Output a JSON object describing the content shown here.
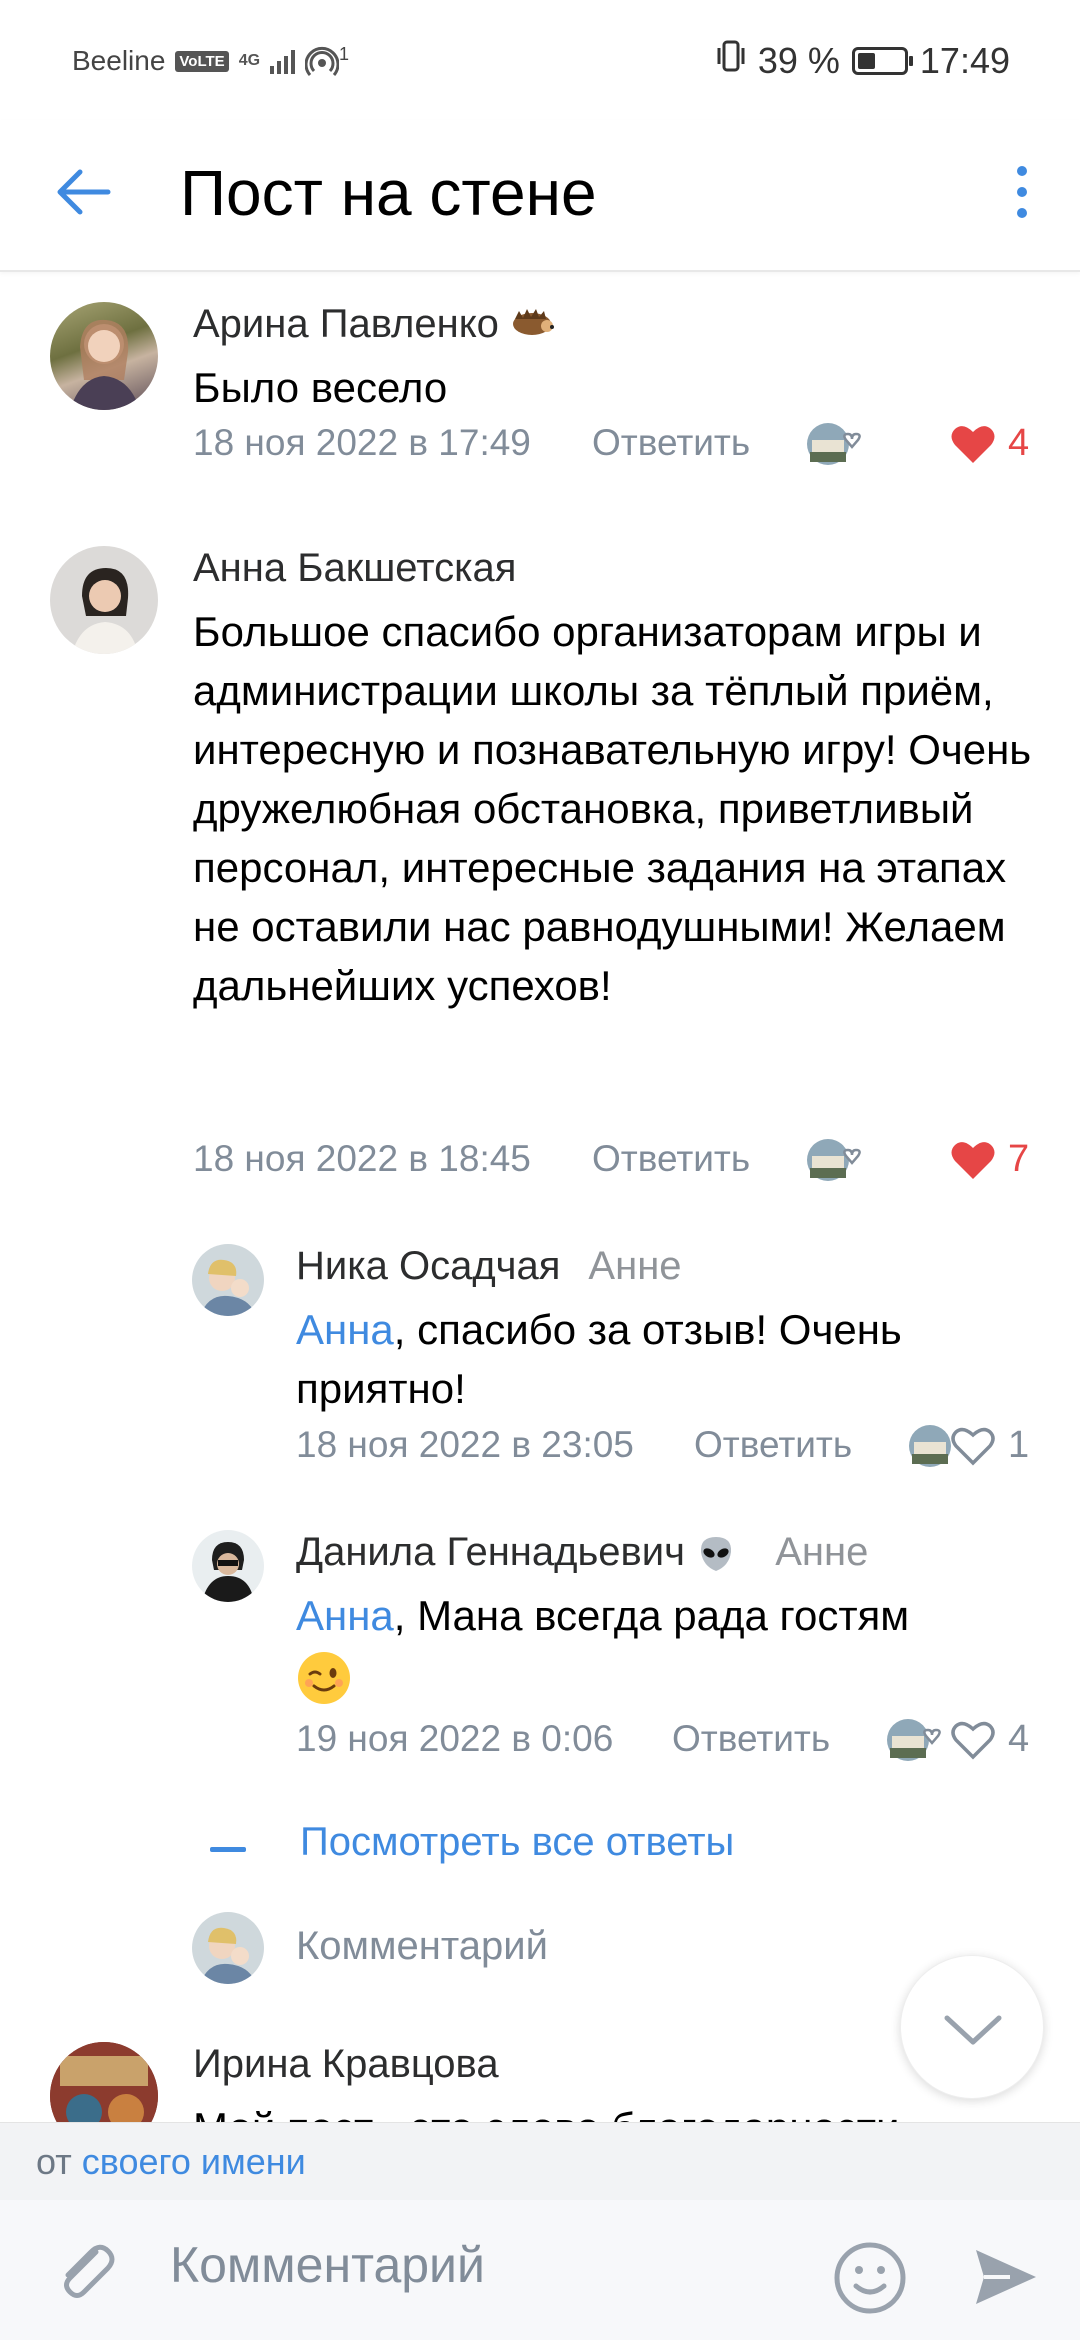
{
  "status": {
    "carrier": "Beeline",
    "volte": "VoLTE",
    "net": "4G",
    "hotspot_count": "1",
    "battery": "39 %",
    "battery_level": 0.39,
    "time": "17:49"
  },
  "header": {
    "title": "Пост на стене"
  },
  "comments": [
    {
      "author": "Арина Павленко",
      "text": "Было весело",
      "date": "18 ноя 2022 в 17:49",
      "reply": "Ответить",
      "likes": "4",
      "liked": true
    },
    {
      "author": "Анна Бакшетская",
      "text": "Большое спасибо организаторам игры и администрации школы за тёплый приём, интересную  и познавательную игру! Очень дружелюбная обстановка, приветливый персонал, интересные задания на этапах не оставили нас равнодушными! Желаем дальнейших успехов!",
      "date": "18 ноя 2022 в 18:45",
      "reply": "Ответить",
      "likes": "7",
      "liked": true
    }
  ],
  "replies": [
    {
      "author": "Ника Осадчая",
      "to": "Анне",
      "mention": "Анна",
      "text": ", спасибо за отзыв! Очень приятно!",
      "date": "18 ноя 2022 в 23:05",
      "reply": "Ответить",
      "likes": "1"
    },
    {
      "author": "Данила Геннадьевич",
      "to": "Анне",
      "mention": "Анна",
      "text": ", Мана всегда рада гостям",
      "date": "19 ноя 2022 в 0:06",
      "reply": "Ответить",
      "likes": "4"
    }
  ],
  "show_all": "Посмотреть все ответы",
  "mini_comment_placeholder": "Комментарий",
  "next_comment": {
    "author": "Ирина Кравцова",
    "text_partial": "Мой пост - это слово благодарности"
  },
  "from_bar": {
    "prefix": "от",
    "who": "своего имени"
  },
  "composer": {
    "placeholder": "Комментарий"
  },
  "colors": {
    "accent": "#3f8ae0",
    "like_red": "#e64646",
    "meta_grey": "#818c99"
  }
}
